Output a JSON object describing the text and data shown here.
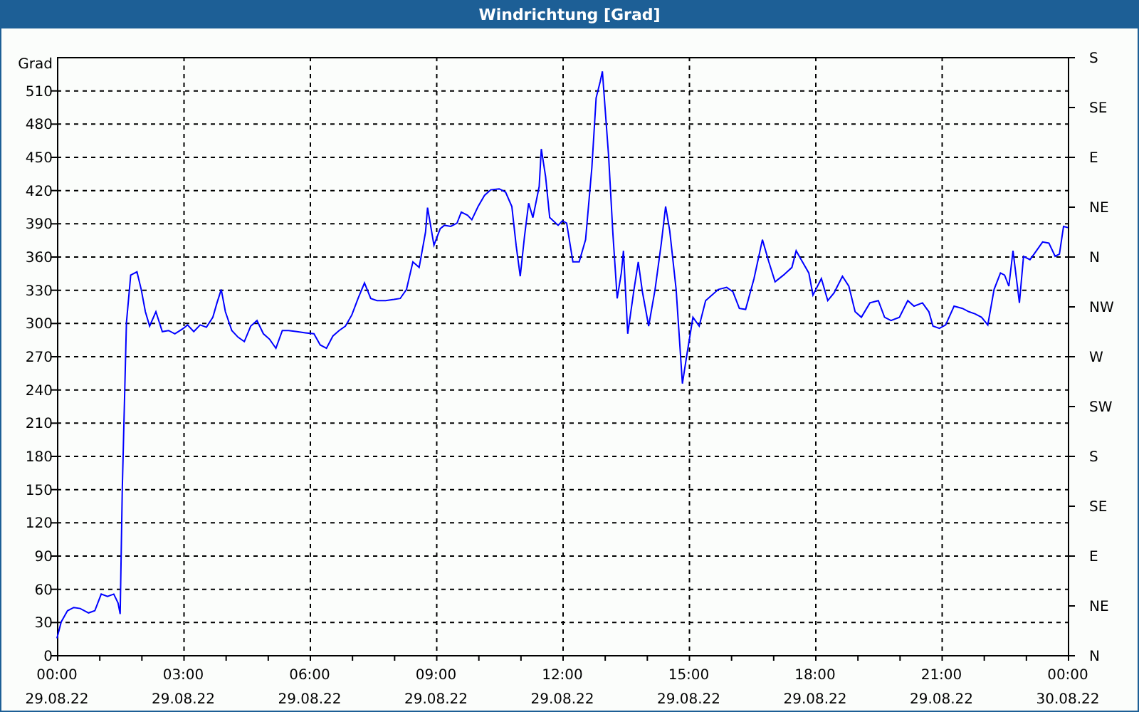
{
  "window": {
    "title": "Windrichtung [Grad]"
  },
  "chart": {
    "chart_data": {
      "type": "line",
      "ylabel": "Grad",
      "grid": true,
      "xlim": [
        0,
        24
      ],
      "ylim": [
        0,
        540
      ],
      "xticks": [
        {
          "value": 0,
          "label": "00:00"
        },
        {
          "value": 3,
          "label": "03:00"
        },
        {
          "value": 6,
          "label": "06:00"
        },
        {
          "value": 9,
          "label": "09:00"
        },
        {
          "value": 12,
          "label": "12:00"
        },
        {
          "value": 15,
          "label": "15:00"
        },
        {
          "value": 18,
          "label": "18:00"
        },
        {
          "value": 21,
          "label": "21:00"
        },
        {
          "value": 24,
          "label": "00:00"
        }
      ],
      "yticks": [
        0,
        30,
        60,
        90,
        120,
        150,
        180,
        210,
        240,
        270,
        300,
        330,
        360,
        390,
        420,
        450,
        480,
        510
      ],
      "x": [
        0,
        0.1,
        0.25,
        0.4,
        0.55,
        0.75,
        0.9,
        1.05,
        1.2,
        1.35,
        1.45,
        1.5,
        1.55,
        1.65,
        1.75,
        1.9,
        2,
        2.1,
        2.2,
        2.35,
        2.5,
        2.65,
        2.8,
        3,
        3.1,
        3.25,
        3.4,
        3.55,
        3.7,
        3.8,
        3.9,
        4,
        4.15,
        4.3,
        4.45,
        4.6,
        4.75,
        4.9,
        5.05,
        5.2,
        5.35,
        5.5,
        5.7,
        5.9,
        6.1,
        6.25,
        6.4,
        6.55,
        6.7,
        6.85,
        7,
        7.15,
        7.3,
        7.45,
        7.6,
        7.8,
        8,
        8.15,
        8.3,
        8.45,
        8.6,
        8.75,
        8.8,
        8.95,
        9.1,
        9.2,
        9.35,
        9.5,
        9.6,
        9.75,
        9.85,
        10,
        10.15,
        10.3,
        10.5,
        10.65,
        10.8,
        10.9,
        11,
        11.1,
        11.2,
        11.3,
        11.45,
        11.5,
        11.6,
        11.7,
        11.9,
        12,
        12.1,
        12.25,
        12.4,
        12.55,
        12.7,
        12.8,
        12.9,
        12.95,
        13.1,
        13.2,
        13.3,
        13.4,
        13.45,
        13.55,
        13.7,
        13.8,
        13.9,
        14.05,
        14.2,
        14.35,
        14.45,
        14.55,
        14.7,
        14.85,
        14.95,
        15.1,
        15.25,
        15.4,
        15.55,
        15.7,
        15.9,
        16.05,
        16.2,
        16.35,
        16.55,
        16.75,
        16.9,
        17.05,
        17.25,
        17.45,
        17.55,
        17.7,
        17.85,
        17.95,
        18.15,
        18.3,
        18.45,
        18.65,
        18.8,
        18.95,
        19.1,
        19.3,
        19.5,
        19.65,
        19.8,
        20,
        20.2,
        20.35,
        20.55,
        20.7,
        20.8,
        20.95,
        21.1,
        21.3,
        21.5,
        21.65,
        21.8,
        21.95,
        22.1,
        22.25,
        22.4,
        22.5,
        22.6,
        22.7,
        22.85,
        22.95,
        23.1,
        23.2,
        23.4,
        23.55,
        23.7,
        23.8,
        23.9,
        24
      ],
      "series": [
        {
          "color": "#0000ff",
          "values": [
            15,
            30,
            40,
            43,
            42,
            38,
            40,
            55,
            53,
            55,
            47,
            37,
            150,
            300,
            343,
            346,
            330,
            310,
            297,
            310,
            292,
            293,
            290,
            295,
            298,
            292,
            298,
            296,
            305,
            318,
            330,
            310,
            293,
            287,
            283,
            297,
            302,
            290,
            285,
            277,
            293,
            293,
            292,
            291,
            290,
            280,
            277,
            288,
            293,
            297,
            307,
            322,
            336,
            322,
            320,
            320,
            321,
            322,
            330,
            355,
            350,
            382,
            404,
            370,
            385,
            388,
            387,
            390,
            400,
            397,
            393,
            405,
            415,
            420,
            421,
            418,
            405,
            370,
            342,
            378,
            408,
            395,
            423,
            457,
            432,
            395,
            388,
            392,
            390,
            355,
            355,
            375,
            440,
            503,
            518,
            527,
            450,
            380,
            322,
            345,
            365,
            290,
            330,
            355,
            328,
            297,
            330,
            372,
            405,
            383,
            330,
            245,
            270,
            305,
            297,
            320,
            325,
            330,
            332,
            328,
            313,
            312,
            340,
            375,
            355,
            337,
            343,
            350,
            365,
            355,
            345,
            325,
            340,
            320,
            327,
            342,
            333,
            310,
            305,
            318,
            320,
            305,
            302,
            305,
            320,
            315,
            318,
            310,
            297,
            295,
            298,
            315,
            313,
            310,
            308,
            305,
            298,
            330,
            345,
            343,
            333,
            365,
            318,
            360,
            357,
            362,
            373,
            372,
            360,
            362,
            387,
            386
          ]
        }
      ]
    },
    "x_axis_dates": [
      "29.08.22",
      "29.08.22",
      "29.08.22",
      "29.08.22",
      "29.08.22",
      "29.08.22",
      "29.08.22",
      "29.08.22",
      "30.08.22"
    ],
    "compass_axis_labels": [
      "S",
      "SE",
      "E",
      "NE",
      "N",
      "NW",
      "W",
      "SW",
      "S",
      "SE",
      "E",
      "NE",
      "N"
    ]
  }
}
